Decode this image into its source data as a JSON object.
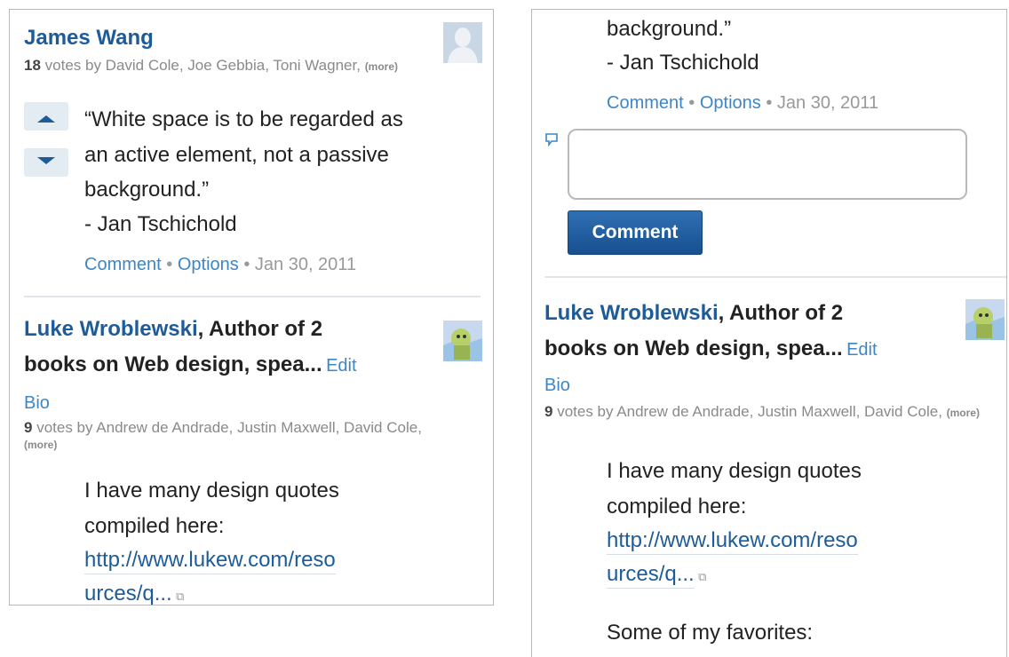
{
  "left_panel": {
    "answer1": {
      "author": "James Wang",
      "vote_count": "18",
      "votes_text": " votes by David Cole, Joe Gebbia, Toni Wagner, ",
      "more": "(more)",
      "quote": [
        "“White space is to be regarded as",
        "an active element, not a passive",
        "background.”",
        "- Jan Tschichold"
      ],
      "comment": "Comment",
      "sep": " • ",
      "options": "Options",
      "date": "Jan 30, 2011"
    },
    "answer2": {
      "author": "Luke Wroblewski",
      "credential_line1": ", Author of 2",
      "credential_line2": "books on Web design, spea...",
      "edit": "Edit",
      "bio": "Bio",
      "vote_count": "9",
      "votes_text": " votes by Andrew de Andrade, Justin Maxwell, David Cole, ",
      "more": "(more)",
      "body_line1": "I have many design quotes",
      "body_line2": "compiled here:",
      "link_line1": "http://www.lukew.com/reso",
      "link_line2": "urces/q...",
      "ext_icon": "external-link-icon"
    }
  },
  "right_panel": {
    "partial_line": "background.”",
    "attribution": "- Jan Tschichold",
    "comment": "Comment",
    "sep": " • ",
    "options": "Options",
    "date": "Jan 30, 2011",
    "comment_input_value": "",
    "comment_button": "Comment",
    "answer2": {
      "author": "Luke Wroblewski",
      "credential_line1": ", Author of 2",
      "credential_line2": "books on Web design, spea...",
      "edit": "Edit",
      "bio": "Bio",
      "vote_count": "9",
      "votes_text": " votes by Andrew de Andrade, Justin Maxwell, David Cole, ",
      "more": "(more)",
      "body_line1": "I have many design quotes",
      "body_line2": "compiled here:",
      "link_line1": "http://www.lukew.com/reso",
      "link_line2": "urces/q...",
      "favorites": "Some of my favorites:"
    }
  },
  "colors": {
    "link": "#1e5c99",
    "light_link": "#3d86c6",
    "button": "#1e5c99",
    "meta": "#999999"
  }
}
